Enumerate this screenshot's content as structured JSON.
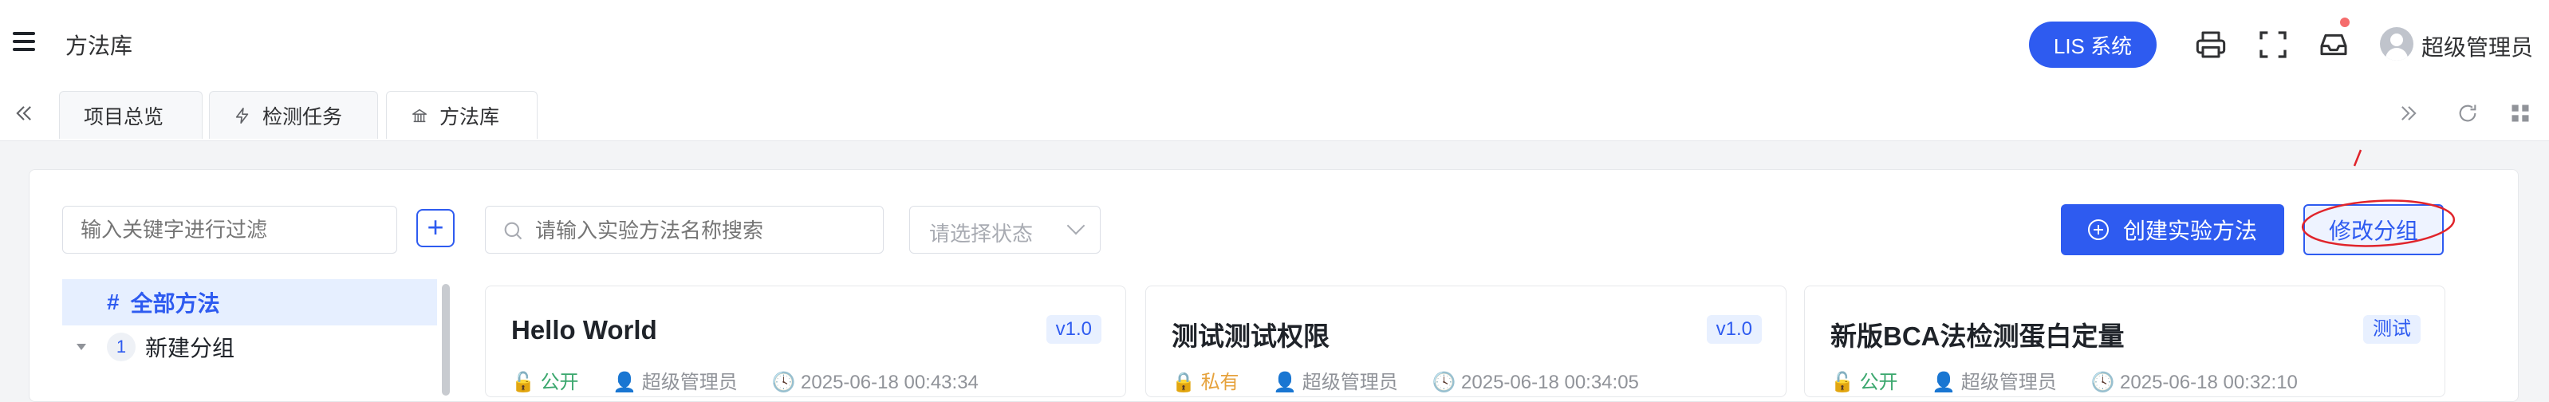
{
  "header": {
    "title": "方法库",
    "lis_button": "LIS 系统",
    "user_name": "超级管理员"
  },
  "tabs": [
    {
      "label": "项目总览"
    },
    {
      "label": "检测任务"
    },
    {
      "label": "方法库"
    }
  ],
  "toolbar": {
    "filter_placeholder": "输入关键字进行过滤",
    "search_placeholder": "请输入实验方法名称搜索",
    "status_placeholder": "请选择状态",
    "create_label": "创建实验方法",
    "edit_group_label": "修改分组"
  },
  "tree": {
    "all_label": "全部方法",
    "all_marker": "#",
    "group_index": "1",
    "group_label": "新建分组"
  },
  "cards": [
    {
      "title": "Hello World",
      "tag": "v1.0",
      "visibility": "公开",
      "author": "超级管理员",
      "time": "2025-06-18 00:43:34"
    },
    {
      "title": "测试测试权限",
      "tag": "v1.0",
      "visibility": "私有",
      "author": "超级管理员",
      "time": "2025-06-18 00:34:05"
    },
    {
      "title": "新版BCA法检测蛋白定量",
      "tag": "测试",
      "visibility": "公开",
      "author": "超级管理员",
      "time": "2025-06-18 00:32:10"
    }
  ],
  "colors": {
    "accent": "#2e5bf0",
    "public": "#3aa76d",
    "private": "#e6a23c",
    "annotation": "#e0242b"
  }
}
